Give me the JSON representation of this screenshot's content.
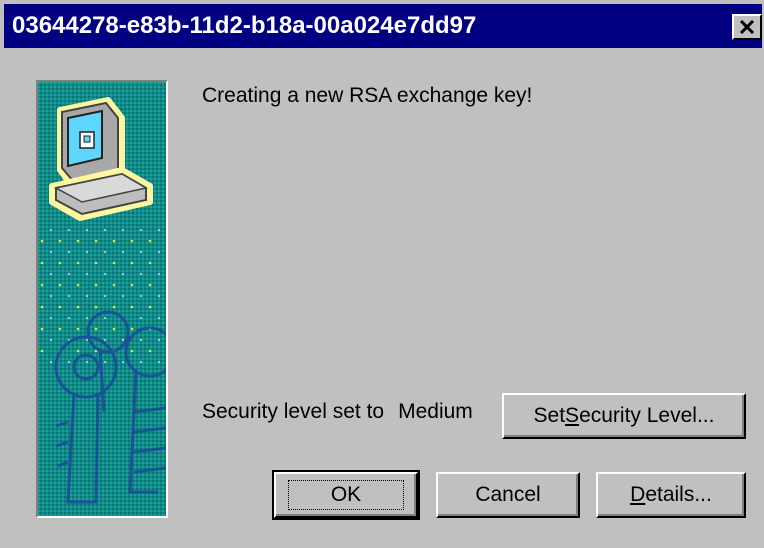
{
  "window": {
    "title": "03644278-e83b-11d2-b18a-00a024e7dd97",
    "close_icon": "close-icon"
  },
  "banner": {
    "computer_icon": "computer-icon",
    "keys_image": "keys-illustration",
    "background_color": "#0f8a86"
  },
  "message": "Creating a new RSA exchange key!",
  "security": {
    "label": "Security level set to",
    "level": "Medium",
    "set_button": {
      "prefix": "Set ",
      "accel": "S",
      "suffix": "ecurity Level..."
    }
  },
  "buttons": {
    "ok": "OK",
    "cancel": "Cancel",
    "details": {
      "accel": "D",
      "suffix": "etails..."
    }
  },
  "colors": {
    "titlebar": "#000080",
    "face": "#c0c0c0",
    "banner": "#0f8a86"
  }
}
